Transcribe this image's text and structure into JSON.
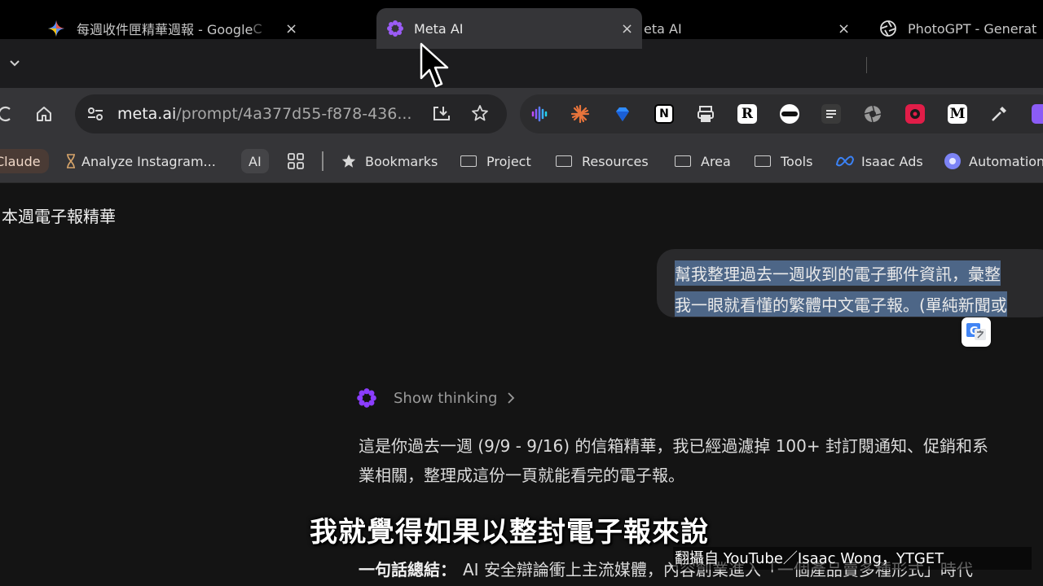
{
  "tabs": [
    {
      "title": "每週收件匣精華週報 - Google",
      "fade": "C",
      "icon": "gemini-icon",
      "close": "×"
    },
    {
      "title": "Meta AI",
      "icon": "meta-ai-icon",
      "close": "×"
    },
    {
      "title": "eta AI",
      "close": "×"
    },
    {
      "title": "PhotoGPT - Generat",
      "icon": "openai-icon"
    }
  ],
  "tab_overflow_icon": "chevron-down-icon",
  "toolbar": {
    "url_host": "meta.ai",
    "url_path": "/prompt/4a377d55-f878-436...",
    "extensions": [
      "audio-ext-icon",
      "claude-spark-icon",
      "gem-icon",
      "notion-icon",
      "print-icon",
      "r-icon",
      "mask-icon",
      "reader-icon",
      "shutter-icon",
      "record-icon",
      "medium-icon",
      "dropper-icon"
    ]
  },
  "bookmarks": {
    "claude": "Claude",
    "analyze": "Analyze Instagram...",
    "ai": "AI",
    "bookmarks": "Bookmarks",
    "project": "Project",
    "resources": "Resources",
    "area": "Area",
    "tools": "Tools",
    "isaac_ads": "Isaac Ads",
    "automation": "Automation"
  },
  "chat": {
    "sidebar_title": "本週電子報精華",
    "user_line1": "幫我整理過去一週收到的電子郵件資訊，彙整",
    "user_line2": "我一眼就看懂的繁體中文電子報。(單純新聞或",
    "show_thinking": "Show thinking",
    "resp_line1": "這是你過去一週 (9/9 - 9/16) 的信箱精華，我已經過濾掉 100+ 封訂閱通知、促銷和系",
    "resp_line2": "業相關，整理成這份一頁就能看完的電子報。",
    "summary_label": "一句話總結：",
    "summary_text": "AI 安全辯論衝上主流媒體，內容創業進入「一個產品賣多種形式」時代"
  },
  "overlay": {
    "subtitle": "我就覺得如果以整封電子報來說",
    "credit": "翻攝自 YouTube／Isaac Wong，YTGET"
  },
  "colors": {
    "selection": "#4d6687",
    "accent_meta": "#8b3dff"
  }
}
